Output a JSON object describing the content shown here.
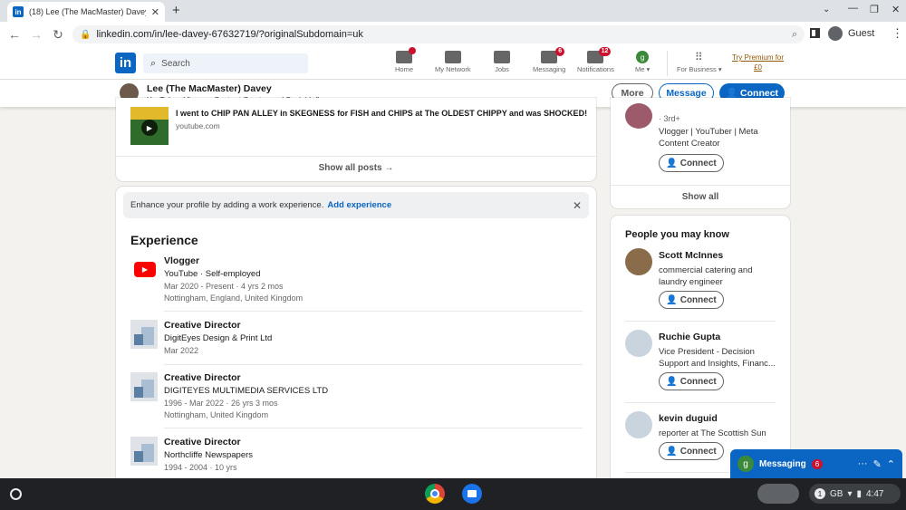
{
  "browser": {
    "tab_title": "(18) Lee (The MacMaster) Davey",
    "url": "linkedin.com/in/lee-davey-67632719/?originalSubdomain=uk",
    "profile_label": "Guest"
  },
  "linkedin_header": {
    "search_placeholder": "Search",
    "nav": [
      {
        "label": "Home",
        "badge": ""
      },
      {
        "label": "My Network",
        "badge": ""
      },
      {
        "label": "Jobs",
        "badge": ""
      },
      {
        "label": "Messaging",
        "badge": "6"
      },
      {
        "label": "Notifications",
        "badge": "12"
      },
      {
        "label": "Me",
        "badge": ""
      }
    ],
    "for_business": "For Business",
    "premium_line1": "Try Premium for",
    "premium_line2": "£0"
  },
  "sticky": {
    "name": "Lee (The MacMaster) Davey",
    "headline": "YouTuber, Vlogger, Content Creator and Social Influencer.",
    "more": "More",
    "message": "Message",
    "connect": "Connect"
  },
  "posts": {
    "video_title": "I went to CHIP PAN ALLEY in SKEGNESS for FISH and CHIPS at The OLDEST CHIPPY and was SHOCKED!",
    "source": "youtube.com",
    "show_all": "Show all posts →"
  },
  "experience": {
    "banner_text": "Enhance your profile by adding a work experience.",
    "banner_link": "Add experience",
    "heading": "Experience",
    "items": [
      {
        "title": "Vlogger",
        "company": "YouTube · Self-employed",
        "dates": "Mar 2020 - Present · 4 yrs 2 mos",
        "location": "Nottingham, England, United Kingdom"
      },
      {
        "title": "Creative Director",
        "company": "DigitEyes Design & Print Ltd",
        "dates": "Mar 2022",
        "location": ""
      },
      {
        "title": "Creative Director",
        "company": "DIGITEYES MULTIMEDIA SERVICES LTD",
        "dates": "1996 - Mar 2022 · 26 yrs 3 mos",
        "location": "Nottingham, United Kingdom"
      },
      {
        "title": "Creative Director",
        "company": "Northcliffe Newspapers",
        "dates": "1994 - 2004 · 10 yrs",
        "location": ""
      }
    ]
  },
  "sidebar_top": {
    "degree": "· 3rd+",
    "desc": "Vlogger | YouTuber | Meta Content Creator",
    "connect": "Connect",
    "show_all": "Show all"
  },
  "people": {
    "heading": "People you may know",
    "list": [
      {
        "name": "Scott McInnes",
        "desc": "commercial catering and laundry engineer",
        "connect": "Connect"
      },
      {
        "name": "Ruchie Gupta",
        "desc": "Vice President - Decision Support and Insights, Financ...",
        "connect": "Connect"
      },
      {
        "name": "kevin duguid",
        "desc": "reporter at The Scottish Sun",
        "connect": "Connect"
      }
    ]
  },
  "messaging": {
    "label": "Messaging",
    "badge": "6",
    "avatar_letter": "g"
  },
  "shelf": {
    "locale": "GB",
    "notif_count": "1",
    "time": "4:47"
  }
}
